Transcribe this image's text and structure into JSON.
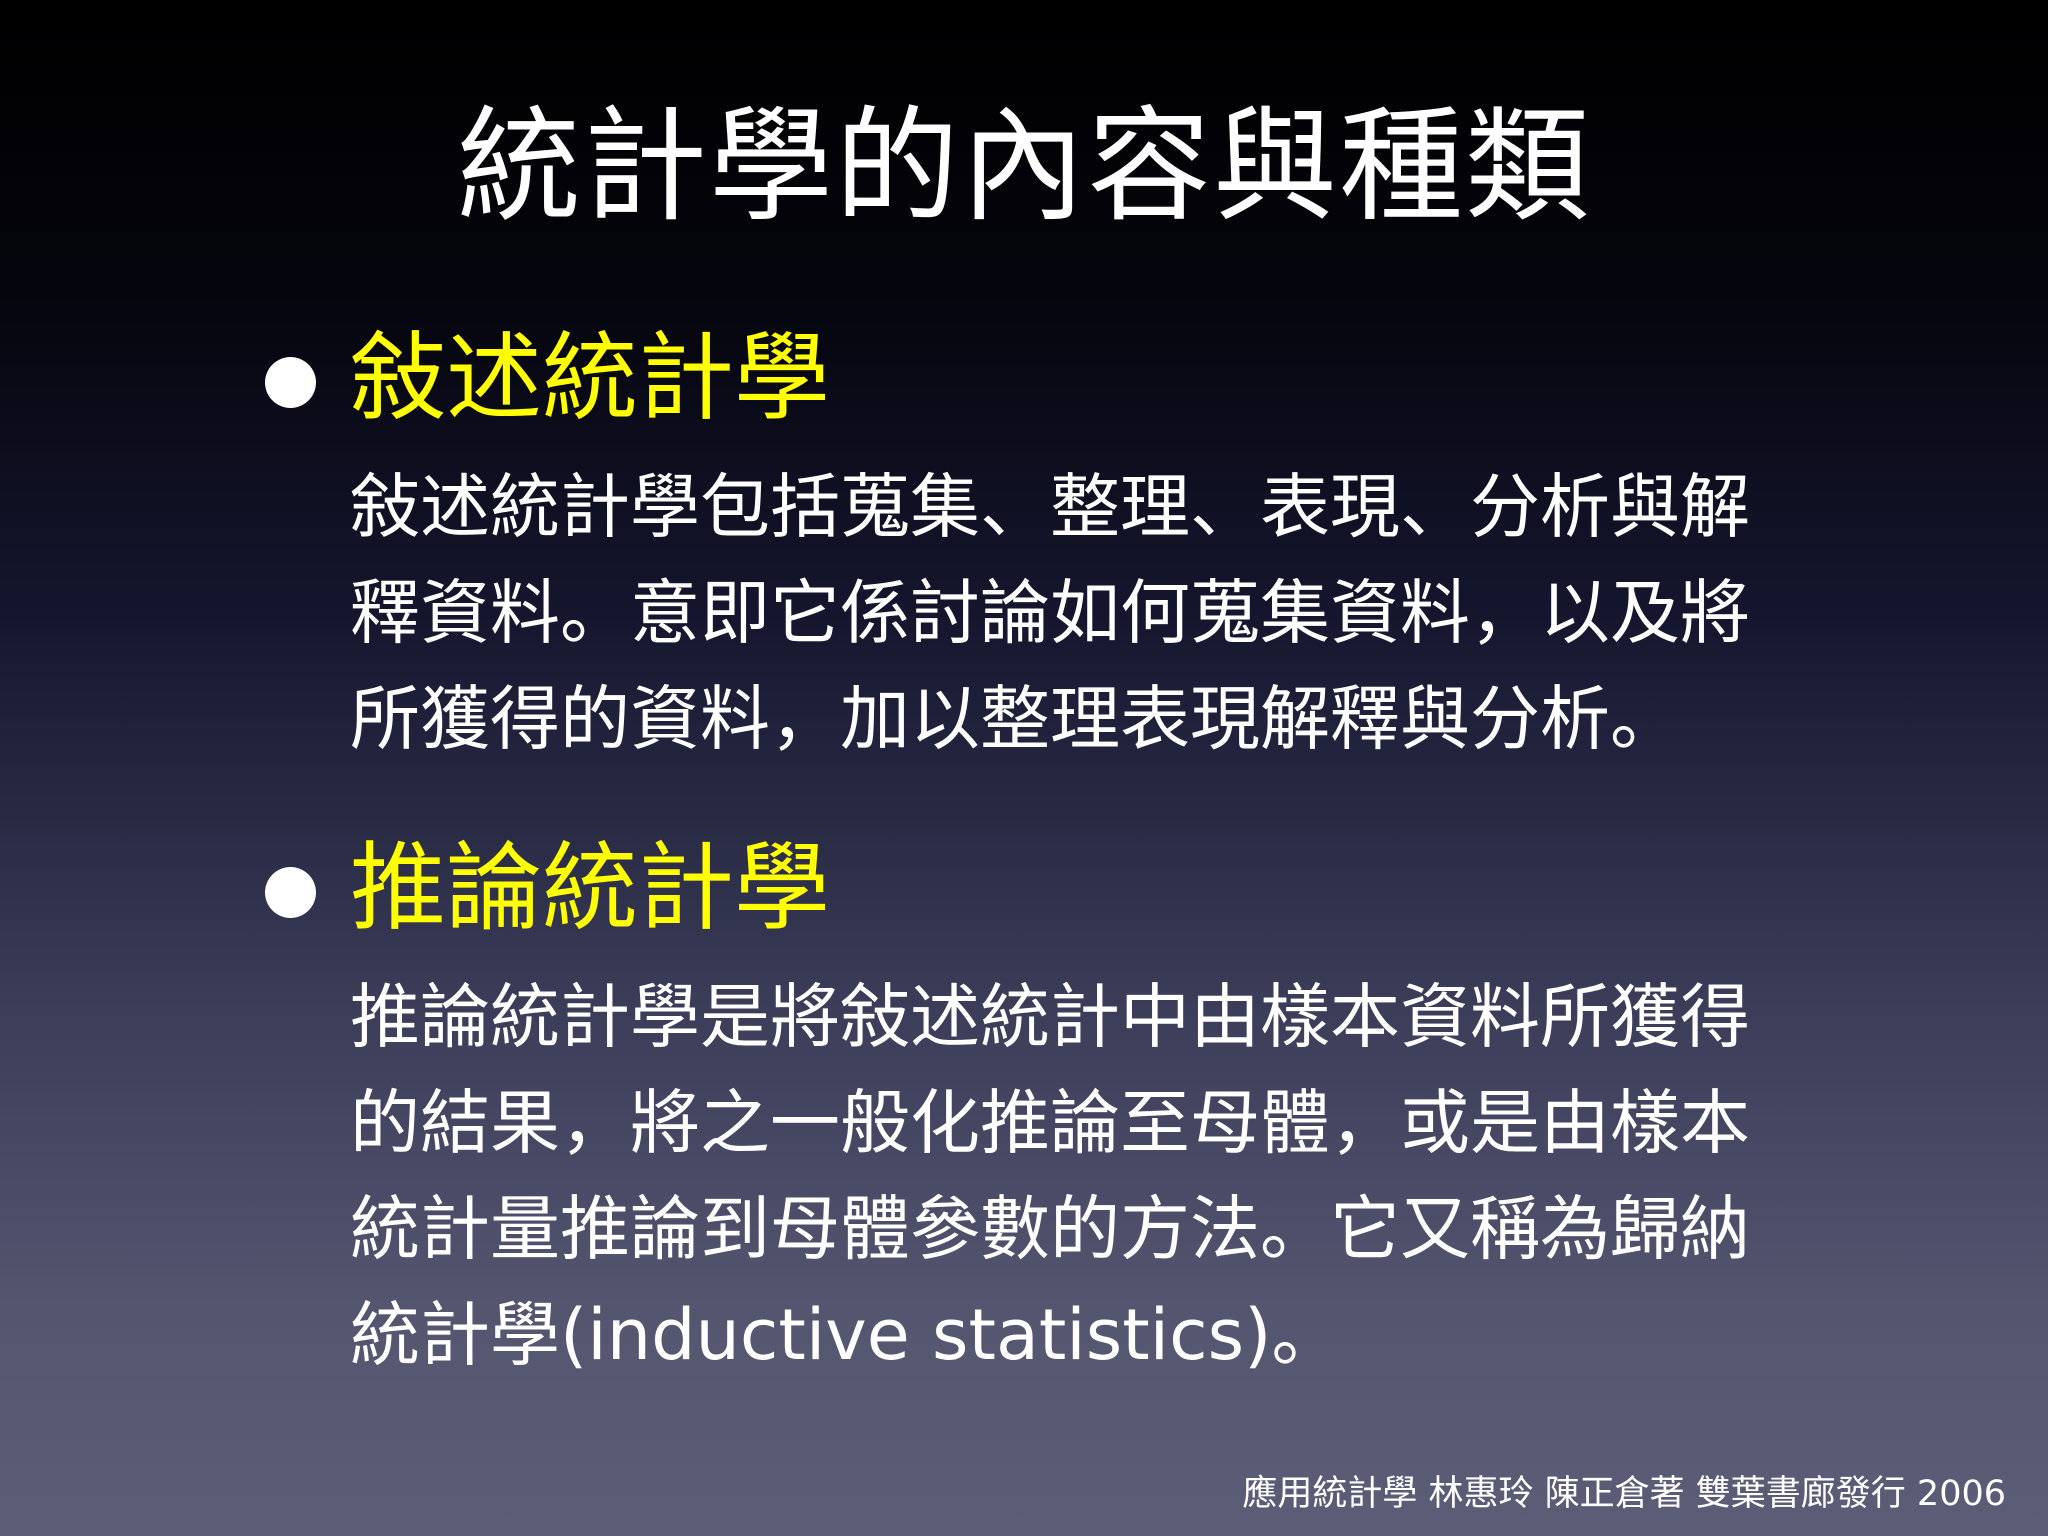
{
  "slide": {
    "title": "統計學的內容與種類",
    "sections": [
      {
        "heading": "敍述統計學",
        "lines": [
          "敍述統計學包括蒐集、整理、表現、分析與解",
          "釋資料。意即它係討論如何蒐集資料，以及將",
          "所獲得的資料，加以整理表現解釋與分析。"
        ]
      },
      {
        "heading": "推論統計學",
        "lines": [
          "推論統計學是將敍述統計中由樣本資料所獲得",
          "的結果，將之一般化推論至母體，或是由樣本",
          "統計量推論到母體參數的方法。它又稱為歸納",
          "統計學(inductive statistics)。"
        ]
      }
    ],
    "footer": "應用統計學  林惠玲 陳正倉著  雙葉書廊發行 2006"
  },
  "colors": {
    "heading": "#ffff00",
    "text": "#ffffff",
    "background_top": "#000000",
    "background_bottom": "#5c5e78"
  }
}
